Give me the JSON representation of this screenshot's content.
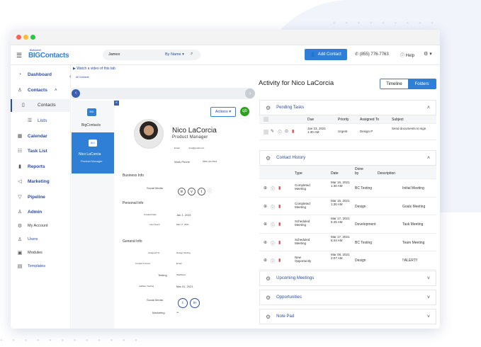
{
  "window": {
    "traffic": [
      "#ff5f57",
      "#febc2e",
      "#28c840"
    ]
  },
  "topbar": {
    "logo_small": "BiaMarket",
    "logo": "BIGContacts",
    "search_value": "James",
    "search_mode": "By Name",
    "add_contact": "Add Contact",
    "phone": "(855) 776-7763",
    "help": "Help"
  },
  "sidebar": {
    "dashboard": "Dashboard",
    "contacts": "Contacts",
    "contacts_sub": "Contacts",
    "lists": "Lists",
    "calendar": "Calendar",
    "task_list": "Task List",
    "reports": "Reports",
    "marketing": "Marketing",
    "pipeline": "Pipeline",
    "admin": "Admin",
    "my_account": "My Account",
    "users": "Users",
    "modules": "Modules",
    "templates": "Templates"
  },
  "contactpanel": {
    "watch_video": "Watch a video of this tab",
    "all_contacts": "All Contacts",
    "company_name": "BigContacts",
    "person_name": "Nico LaCorcia",
    "person_title": "Product Manager",
    "actions": "Actions",
    "name": "Nico LaCorcia",
    "title": "Product Manager",
    "email_label": "Email",
    "email_value": "nico@gmail.com",
    "work_phone_label": "Work Phone",
    "work_phone_value": "(555) 441 5521",
    "business_info": "Business Info",
    "social_media": "Social Media",
    "personal_info": "Personal Info",
    "created_date_label": "Created Date",
    "created_date_value": "Jan 1, 2021",
    "last_touch_label": "Last Touch",
    "last_touch_value": "Mar 17, 2021",
    "general_info": "General Info",
    "assigned_to_label": "Assigned To",
    "assigned_to_value": "Design Testing",
    "contact_format_label": "Contact Format",
    "contact_format_value": "Email",
    "testing_label": "Testing",
    "testing_value": "Webflows",
    "add_date_label": "Addition Testing",
    "add_date_value": "Mar 01, 2021",
    "social_media2": "Social Media",
    "marketing_label": "Marketing",
    "marketing_value": "no"
  },
  "activity": {
    "title": "Activity for Nico LaCorcia",
    "tab_timeline": "Timeline",
    "tab_folders": "Folders",
    "pending_tasks": "Pending Tasks",
    "pt_headers": [
      "Due",
      "Priority",
      "Assigned To",
      "Subject"
    ],
    "pt_rows": [
      {
        "due": "Jan 23, 2021 1:30 AM",
        "priority": "Urgent",
        "assigned": "Design P",
        "subject": "Send documents to sign"
      }
    ],
    "contact_history": "Contact History",
    "ch_headers": [
      "Type",
      "Date",
      "Done by",
      "Description"
    ],
    "ch_rows": [
      {
        "type": "Completed Meeting",
        "date": "Mar 16, 2021 1:30 AM",
        "by": "BC Testing",
        "desc": "Initial Meeting"
      },
      {
        "type": "Completed Meeting",
        "date": "Mar 16, 2021 1:30 AM",
        "by": "Design",
        "desc": "Goals Meeting"
      },
      {
        "type": "Scheduled Meeting",
        "date": "Mar 17, 2021 6:45 AM",
        "by": "Development",
        "desc": "Task Meeting"
      },
      {
        "type": "Scheduled Meeting",
        "date": "Mar 17, 2021 6:44 AM",
        "by": "BC Testing",
        "desc": "Team Meeting"
      },
      {
        "type": "New Opportunity",
        "date": "Mar 08, 2021 2:07 AM",
        "by": "Design",
        "desc": "!!ALERT!!"
      }
    ],
    "upcoming_meetings": "Upcoming Meetings",
    "opportunities": "Opportunities",
    "note_pad": "Note Pad"
  }
}
